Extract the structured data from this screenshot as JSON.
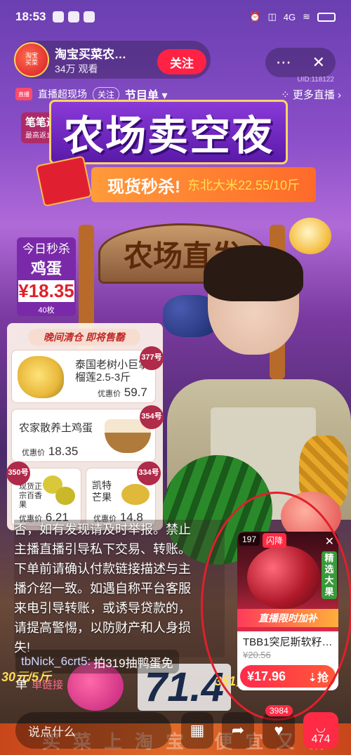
{
  "status_bar": {
    "time": "18:53",
    "network": "4G"
  },
  "header": {
    "host_name": "淘宝买菜农…",
    "viewers": "34万 观看",
    "follow_label": "关注",
    "more_icon": "more-icon",
    "close_icon": "close-icon",
    "uid": "UID:118122"
  },
  "channel": {
    "logo": "直播",
    "name": "直播超现场",
    "follow_chip": "关注",
    "program": "节目单",
    "more_live": "更多直播"
  },
  "banner": {
    "title": "农场卖空夜",
    "subtitle": "现货秒杀!",
    "rice": "东北大米22.55/10斤",
    "redpack_title": "笔笔返红包",
    "redpack_sub": "最高返100元"
  },
  "farm_sign": "农场直发",
  "today_deal": {
    "label": "今日秒杀",
    "item": "鸡蛋",
    "price": "¥18.35",
    "qty": "40枚"
  },
  "board": {
    "title": "晚间清仓 即将售罄",
    "items": [
      {
        "badge": "377号",
        "name": "泰国老树小巨掌榴莲2.5-3斤",
        "price": "59.7",
        "cur": "优惠价"
      },
      {
        "badge": "354号",
        "name": "农家散养土鸡蛋",
        "price": "18.35",
        "cur": "优惠价"
      },
      {
        "badge": "350号",
        "name": "现货正宗百香果",
        "price": "6.21",
        "cur": "优惠价"
      },
      {
        "badge": "334号",
        "name": "凯特芒果",
        "price": "14.8",
        "cur": "优惠价"
      }
    ]
  },
  "notice": {
    "lines": [
      "否，如有发现请及时举报。禁止",
      "主播直播引导私下交易、转账。",
      "下单前请确认付款链接描述与主",
      "播介绍一致。如遇自称平台客服",
      "来电引导转账，或诱导贷款的，",
      "请提高警惕，以防财产和人身损",
      "失!"
    ]
  },
  "chat": {
    "user": "tbNick_6crt5:",
    "text": "拍319抽鸭蛋免",
    "cont": "单"
  },
  "promo": {
    "left": "30元/5斤",
    "big": "71.4",
    "right": "351元/3-4斤",
    "tag": "单链接"
  },
  "product_card": {
    "num": "197",
    "flash": "闪降",
    "select": "精选大果",
    "banner": "直播限时加补",
    "name": "TBB1突尼斯软籽…",
    "orig_price": "¥20.56",
    "price": "¥17.96",
    "buy": "抢"
  },
  "bottom": {
    "comment_placeholder": "说点什么",
    "slogan": "买菜上淘宝 便宜又新鲜",
    "like_count": "3984",
    "cart_count": "474"
  }
}
